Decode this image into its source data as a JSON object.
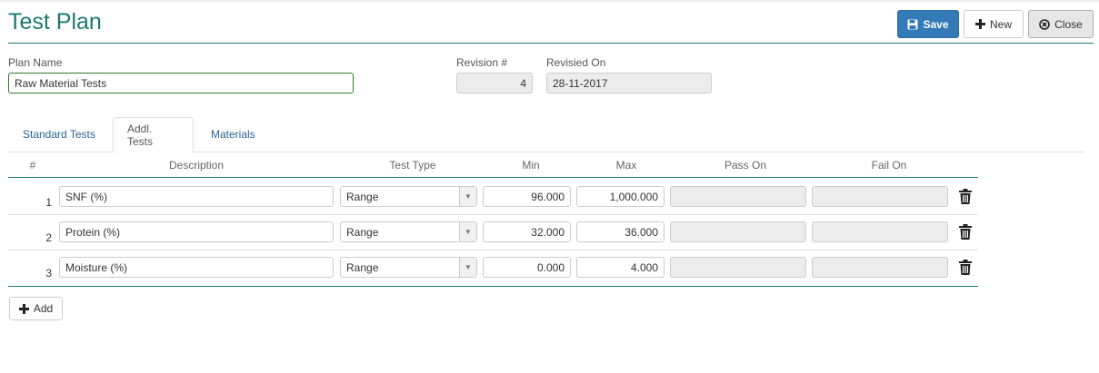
{
  "header": {
    "title": "Test Plan",
    "save_label": "Save",
    "new_label": "New",
    "close_label": "Close"
  },
  "form": {
    "plan_name_label": "Plan Name",
    "plan_name_value": "Raw Material Tests",
    "revision_label": "Revision #",
    "revision_value": "4",
    "revised_on_label": "Revisied On",
    "revised_on_value": "28-11-2017"
  },
  "tabs": [
    {
      "label": "Standard Tests"
    },
    {
      "label": "Addl. Tests",
      "active": true
    },
    {
      "label": "Materials"
    }
  ],
  "table": {
    "columns": [
      "#",
      "Description",
      "Test Type",
      "Min",
      "Max",
      "Pass On",
      "Fail On"
    ],
    "rows": [
      {
        "num": "1",
        "description": "SNF (%)",
        "type": "Range",
        "min": "96.000",
        "max": "1,000.000",
        "pass_on": "",
        "fail_on": ""
      },
      {
        "num": "2",
        "description": "Protein (%)",
        "type": "Range",
        "min": "32.000",
        "max": "36.000",
        "pass_on": "",
        "fail_on": ""
      },
      {
        "num": "3",
        "description": "Moisture (%)",
        "type": "Range",
        "min": "0.000",
        "max": "4.000",
        "pass_on": "",
        "fail_on": ""
      }
    ]
  },
  "footer": {
    "add_label": "Add"
  },
  "colors": {
    "accent": "#1a7a72",
    "primary_button": "#337ab7",
    "link": "#2a6496"
  }
}
